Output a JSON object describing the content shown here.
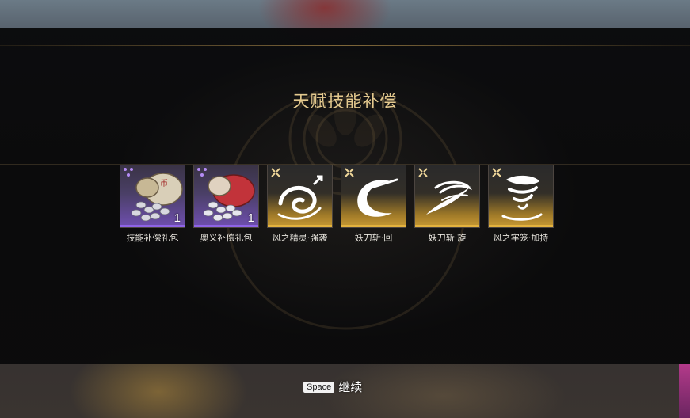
{
  "dialog": {
    "title": "天赋技能补偿"
  },
  "rewards": [
    {
      "label": "技能补偿礼包",
      "count": "1",
      "rarity": "purple",
      "icon": "coin-bag-icon"
    },
    {
      "label": "奥义补偿礼包",
      "count": "1",
      "rarity": "purple",
      "icon": "red-coin-bag-icon"
    },
    {
      "label": "风之精灵·强袭",
      "count": "",
      "rarity": "gold",
      "icon": "wind-spirit-icon"
    },
    {
      "label": "妖刀斩·回",
      "count": "",
      "rarity": "gold",
      "icon": "crescent-slash-icon"
    },
    {
      "label": "妖刀斩·旋",
      "count": "",
      "rarity": "gold",
      "icon": "spiral-slash-icon"
    },
    {
      "label": "风之牢笼·加持",
      "count": "",
      "rarity": "gold",
      "icon": "tornado-icon"
    }
  ],
  "footer": {
    "key": "Space",
    "action": "继续"
  },
  "colors": {
    "title": "#e4c98e",
    "purple_rarity": "#8e63e6",
    "gold_rarity": "#e3b23e"
  }
}
